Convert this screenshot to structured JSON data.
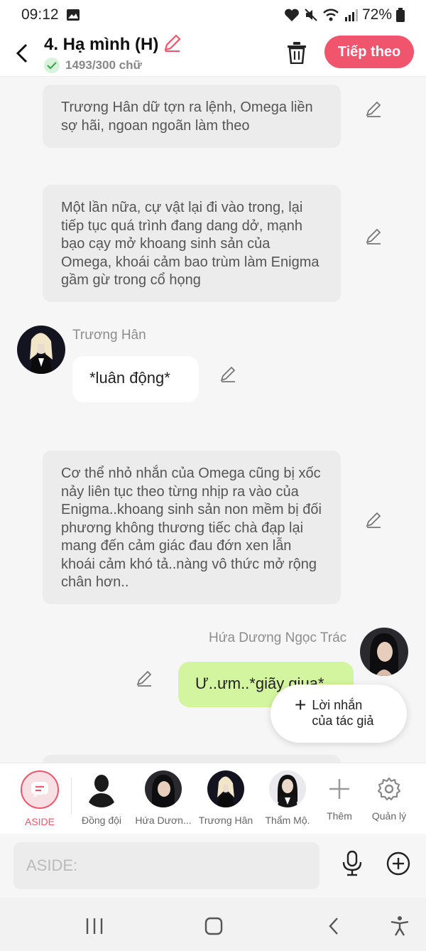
{
  "status_bar": {
    "time": "09:12",
    "battery": "72%"
  },
  "header": {
    "title": "4. Hạ mình (H)",
    "word_count": "1493/300 chữ",
    "next_label": "Tiếp theo"
  },
  "messages": {
    "narr1": "Trương Hân dữ tợn ra lệnh, Omega liền sợ hãi, ngoan ngoãn làm theo",
    "narr2": "Một lần nữa, cự vật lại đi vào trong, lại tiếp tục quá trình đang dang dở, mạnh bạo cạy mở khoang sinh sản của Omega, khoái cảm bao trùm làm Enigma gầm gừ trong cổ họng",
    "speaker1_name": "Trương Hân",
    "speaker1_text": "*luân động*",
    "narr3": "Cơ thể nhỏ nhắn của Omega cũng bị xốc nảy liên tục theo từng nhịp ra vào của Enigma..khoang sinh sản non mềm bị đối phương không thương tiếc chà đạp lại mang đến cảm giác đau đớn xen lẫn khoái cảm khó tả..nàng vô thức mở rộng chân hơn..",
    "speaker2_name": "Hứa Dương Ngọc Trác",
    "speaker2_text": "Ư..ưm..*giãy giụa*"
  },
  "author_popup": {
    "line1": "Lời nhắn",
    "line2": "của tác giả"
  },
  "characters": {
    "aside": "ASIDE",
    "items": [
      "Đồng đội",
      "Hứa Dươn...",
      "Trương Hân",
      "Thẩm Mộ."
    ],
    "add": "Thêm",
    "manage": "Quản lý"
  },
  "composer": {
    "placeholder": "ASIDE:"
  },
  "colors": {
    "accent": "#f0556d",
    "bubble_green": "#d4f5a0",
    "narration_bg": "#ececec"
  }
}
